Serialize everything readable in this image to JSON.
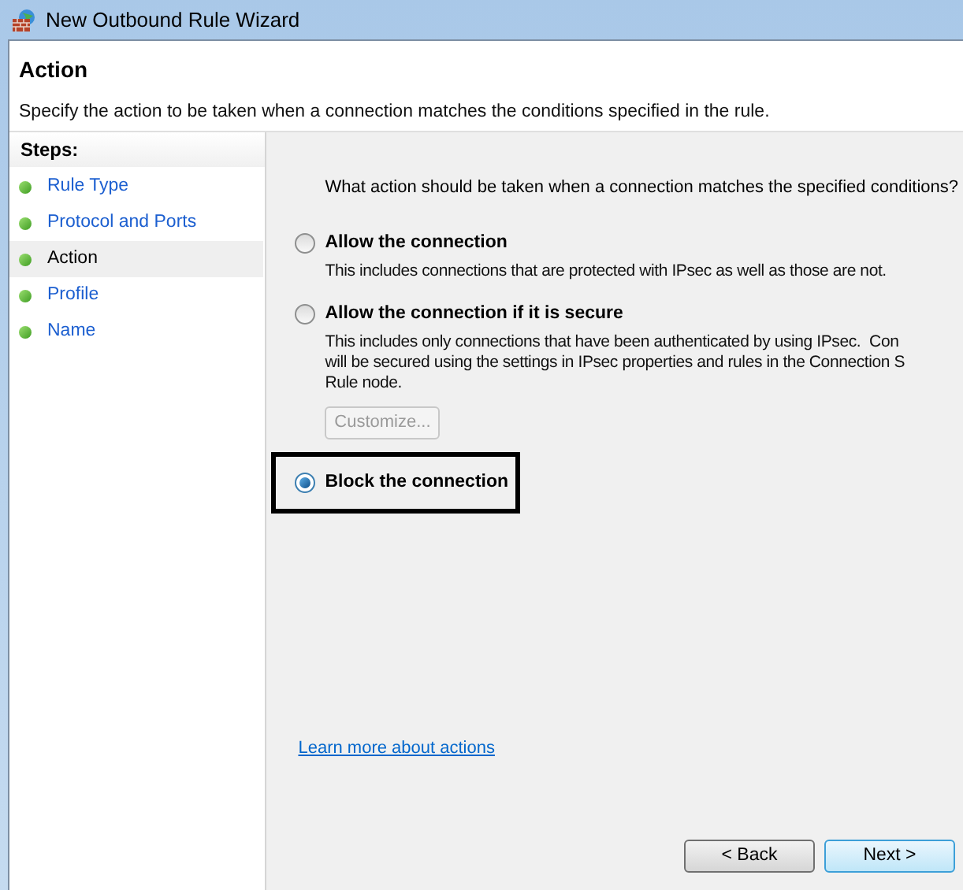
{
  "window": {
    "title": "New Outbound Rule Wizard"
  },
  "header": {
    "title": "Action",
    "subtitle": "Specify the action to be taken when a connection matches the conditions specified in the rule."
  },
  "steps": {
    "heading": "Steps:",
    "items": [
      {
        "label": "Rule Type",
        "selected": false
      },
      {
        "label": "Protocol and Ports",
        "selected": false
      },
      {
        "label": "Action",
        "selected": true
      },
      {
        "label": "Profile",
        "selected": false
      },
      {
        "label": "Name",
        "selected": false
      }
    ]
  },
  "question": "What action should be taken when a connection matches the specified conditions?",
  "options": [
    {
      "label": "Allow the connection",
      "selected": false,
      "highlighted": false,
      "description": [
        "This includes connections that are protected with IPsec as well as those are not."
      ]
    },
    {
      "label": "Allow the connection if it is secure",
      "selected": false,
      "highlighted": false,
      "description": [
        "This includes only connections that have been authenticated by using IPsec.  Con",
        "will be secured using the settings in IPsec properties and rules in the Connection S",
        "Rule node."
      ],
      "button": {
        "label": "Customize...",
        "disabled": true
      }
    },
    {
      "label": "Block the connection",
      "selected": true,
      "highlighted": true
    }
  ],
  "link": "Learn more about actions",
  "buttons": [
    {
      "label": "< Back",
      "default": false
    },
    {
      "label": "Next >",
      "default": true
    }
  ]
}
